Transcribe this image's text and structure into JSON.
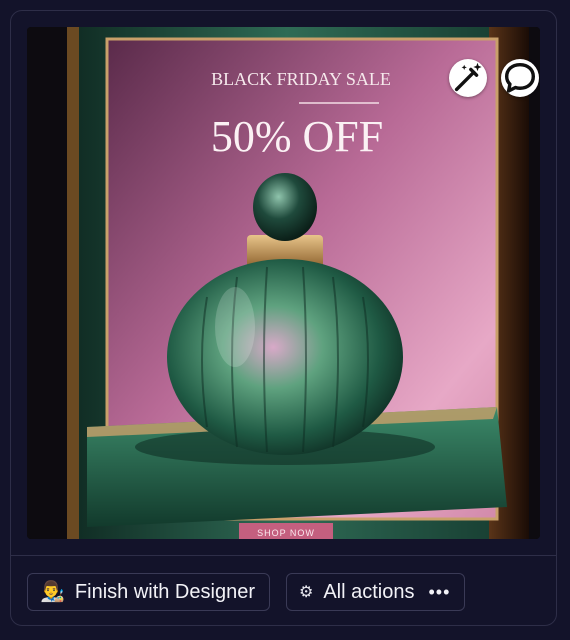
{
  "image": {
    "headline": "BLACK FRIDAY SALE",
    "offer": "50% OFF",
    "cta": "SHOP NOW"
  },
  "overlay": {
    "edit_icon": "magic-edit-icon",
    "comment_icon": "comment-bubble-icon",
    "annotation": "red-arrow-pointer"
  },
  "actions": {
    "designer_emoji": "👨‍🎨",
    "designer_label": "Finish with Designer",
    "all_actions_icon": "⚙",
    "all_actions_label": "All actions",
    "more_icon": "•••"
  },
  "colors": {
    "background": "#13132a",
    "border": "#2e2e48",
    "annotation_red": "#e5261f"
  }
}
